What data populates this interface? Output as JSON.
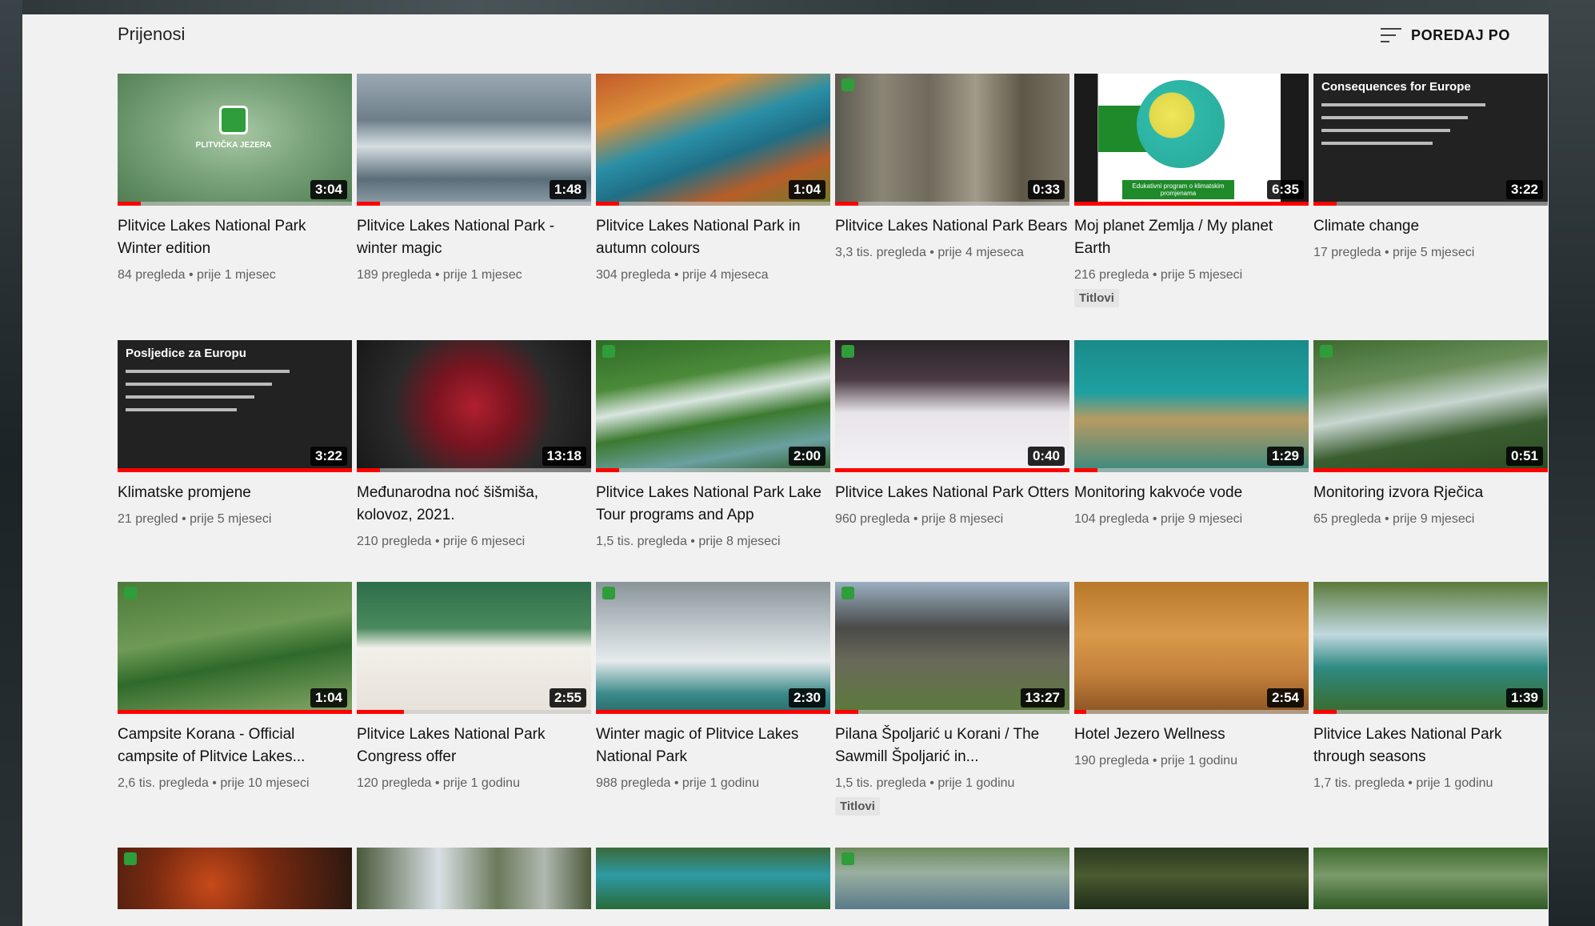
{
  "header": {
    "title": "Prijenosi",
    "sort_label": "POREDAJ PO"
  },
  "videos": [
    {
      "title": "Plitvice Lakes National Park Winter edition",
      "meta": "84 pregleda • prije 1 mjesec",
      "duration": "3:04",
      "watched": 0.1,
      "badge": "",
      "scene": "winter-logo",
      "overlay_text": "PLITVIČKA JEZERA"
    },
    {
      "title": "Plitvice Lakes National Park - winter magic",
      "meta": "189 pregleda • prije 1 mjesec",
      "duration": "1:48",
      "watched": 0.1,
      "badge": "",
      "scene": "snow-lakes"
    },
    {
      "title": "Plitvice Lakes National Park in autumn colours",
      "meta": "304 pregleda • prije 4 mjeseca",
      "duration": "1:04",
      "watched": 0.1,
      "badge": "",
      "scene": "autumn"
    },
    {
      "title": "Plitvice Lakes National Park Bears",
      "meta": "3,3 tis. pregleda • prije 4 mjeseca",
      "duration": "0:33",
      "watched": 0.1,
      "badge": "",
      "scene": "forest-bear"
    },
    {
      "title": "Moj planet Zemlja / My planet Earth",
      "meta": "216 pregleda • prije 5 mjeseci",
      "duration": "6:35",
      "watched": 1.0,
      "badge": "Titlovi",
      "scene": "earth-cartoon",
      "overlay_text": "Edukativni program o klimatskim promjenama"
    },
    {
      "title": "Climate change",
      "meta": "17 pregleda • prije 5 mjeseci",
      "duration": "3:22",
      "watched": 0.1,
      "badge": "",
      "scene": "slide-en",
      "overlay_text": "Consequences for Europe"
    },
    {
      "title": "Klimatske promjene",
      "meta": "21 pregled • prije 5 mjeseci",
      "duration": "3:22",
      "watched": 1.0,
      "badge": "",
      "scene": "slide-hr",
      "overlay_text": "Posljedice za Europu"
    },
    {
      "title": "Međunarodna noć šišmiša, kolovoz, 2021.",
      "meta": "210 pregleda • prije 6 mjeseci",
      "duration": "13:18",
      "watched": 0.1,
      "badge": "",
      "scene": "bat-gloves"
    },
    {
      "title": "Plitvice Lakes National Park Lake Tour programs and App",
      "meta": "1,5 tis. pregleda • prije 8 mjeseci",
      "duration": "2:00",
      "watched": 0.1,
      "badge": "",
      "scene": "waterfall-green"
    },
    {
      "title": "Plitvice Lakes National Park Otters",
      "meta": "960 pregleda • prije 8 mjeseci",
      "duration": "0:40",
      "watched": 1.0,
      "badge": "",
      "scene": "otter-snow"
    },
    {
      "title": "Monitoring kakvoće vode",
      "meta": "104 pregleda • prije 9 mjeseci",
      "duration": "1:29",
      "watched": 0.1,
      "badge": "",
      "scene": "underwater"
    },
    {
      "title": "Monitoring izvora Rječica",
      "meta": "65 pregleda • prije 9 mjeseci",
      "duration": "0:51",
      "watched": 1.0,
      "badge": "",
      "scene": "cascade"
    },
    {
      "title": "Campsite Korana - Official campsite of Plitvice Lakes...",
      "meta": "2,6 tis. pregleda • prije 10 mjeseci",
      "duration": "1:04",
      "watched": 1.0,
      "badge": "",
      "scene": "aerial-campsite"
    },
    {
      "title": "Plitvice Lakes National Park Congress offer",
      "meta": "120 pregleda • prije 1 godinu",
      "duration": "2:55",
      "watched": 0.2,
      "badge": "",
      "scene": "buffet"
    },
    {
      "title": "Winter magic of Plitvice Lakes National Park",
      "meta": "988 pregleda • prije 1 godinu",
      "duration": "2:30",
      "watched": 1.0,
      "badge": "",
      "scene": "winter-falls"
    },
    {
      "title": "Pilana Špoljarić u Korani / The Sawmill Špoljarić in...",
      "meta": "1,5 tis. pregleda • prije 1 godinu",
      "duration": "13:27",
      "watched": 0.1,
      "badge": "Titlovi",
      "scene": "sawmill"
    },
    {
      "title": "Hotel Jezero Wellness",
      "meta": "190 pregleda • prije 1 godinu",
      "duration": "2:54",
      "watched": 0.05,
      "badge": "",
      "scene": "sauna"
    },
    {
      "title": "Plitvice Lakes National Park through seasons",
      "meta": "1,7 tis. pregleda • prije 1 godinu",
      "duration": "1:39",
      "watched": 0.1,
      "badge": "",
      "scene": "falls-seasons"
    },
    {
      "title": "",
      "meta": "",
      "duration": "",
      "watched": 0,
      "badge": "",
      "scene": "grill"
    },
    {
      "title": "",
      "meta": "",
      "duration": "",
      "watched": 0,
      "badge": "",
      "scene": "falls-forest"
    },
    {
      "title": "",
      "meta": "",
      "duration": "",
      "watched": 0,
      "badge": "",
      "scene": "aerial-lake"
    },
    {
      "title": "",
      "meta": "",
      "duration": "",
      "watched": 0,
      "badge": "",
      "scene": "boardwalk"
    },
    {
      "title": "",
      "meta": "",
      "duration": "",
      "watched": 0,
      "badge": "",
      "scene": "kayak"
    },
    {
      "title": "",
      "meta": "",
      "duration": "",
      "watched": 0,
      "badge": "",
      "scene": "falls-green"
    }
  ],
  "colors": {
    "progress": "#ff0000",
    "panel_bg": "#f1f1f1",
    "title_text": "#111111",
    "meta_text": "#606060"
  },
  "icons": {
    "sort": "sort-lines-icon"
  }
}
